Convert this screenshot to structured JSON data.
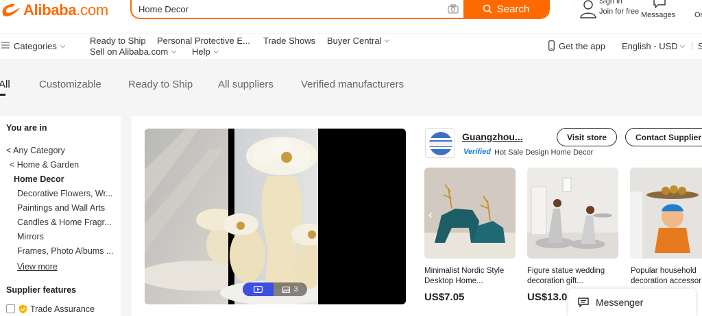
{
  "header": {
    "logo": {
      "text": "Alibaba",
      "suffix": ".com",
      "color": "#ff6a00"
    },
    "search": {
      "value": "Home Decor",
      "button_label": "Search",
      "icon": "search-icon"
    },
    "signin": {
      "line1": "Sign in",
      "line2": "Join for free"
    },
    "messages_label": "Messages",
    "orders_label": "Or"
  },
  "nav": {
    "categories": "Categories",
    "ready_to_ship": "Ready to Ship",
    "ppe": "Personal Protective E...",
    "trade_shows": "Trade Shows",
    "buyer_central": "Buyer Central",
    "sell": "Sell on Alibaba.com",
    "help": "Help",
    "get_app": "Get the app",
    "language": "English - USD",
    "extra": "S"
  },
  "tabs": [
    {
      "label": "All",
      "active": true
    },
    {
      "label": "Customizable",
      "active": false
    },
    {
      "label": "Ready to Ship",
      "active": false
    },
    {
      "label": "All suppliers",
      "active": false
    },
    {
      "label": "Verified manufacturers",
      "active": false
    }
  ],
  "sidebar": {
    "you_are_in": "You are in",
    "crumbs": [
      "< Any Category",
      "< Home & Garden"
    ],
    "current": "Home Decor",
    "subcategories": [
      "Decorative Flowers, Wr...",
      "Paintings and Wall Arts",
      "Candles & Home Fragr...",
      "Mirrors",
      "Frames, Photo Albums ..."
    ],
    "view_more": "View more",
    "supplier_features_title": "Supplier features",
    "trade_assurance": "Trade Assurance"
  },
  "supplier": {
    "name": "Guangzhou...",
    "verified": "Verified",
    "subtitle": "Hot Sale Design Home Decor",
    "visit_store": "Visit store",
    "contact": "Contact Supplier"
  },
  "media_pager": {
    "count": "3"
  },
  "products": [
    {
      "title_line1": "Minimalist Nordic Style",
      "title_line2": "Desktop Home...",
      "price": "US$7.05"
    },
    {
      "title_line1": "Figure statue wedding",
      "title_line2": "decoration gift...",
      "price": "US$13.0"
    },
    {
      "title_line1": "Popular household",
      "title_line2": "decoration accessor",
      "price": ""
    }
  ],
  "messenger": {
    "label": "Messenger"
  },
  "colors": {
    "accent": "#ff6a00",
    "verified": "#1a7bd8",
    "pager_active": "#3c50e0"
  }
}
